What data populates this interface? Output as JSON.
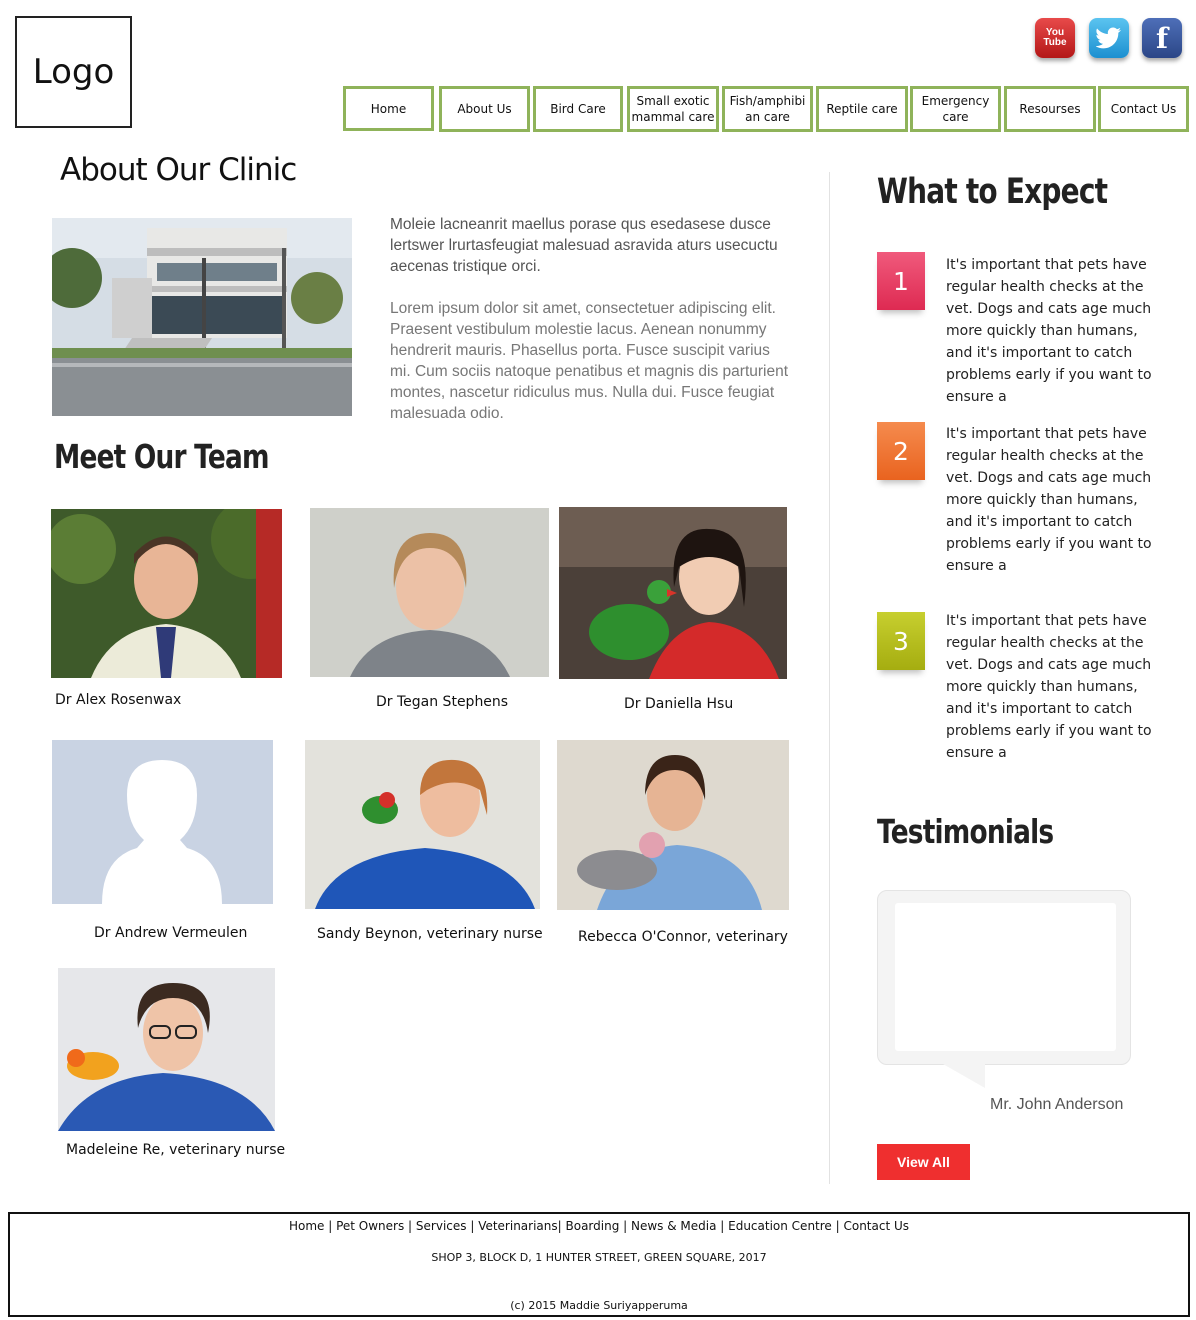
{
  "header": {
    "logo_text": "Logo",
    "social": [
      {
        "name": "youtube",
        "label": "You\nTube",
        "color": "#d32323"
      },
      {
        "name": "twitter",
        "label": "t",
        "color": "#2aa9e0"
      },
      {
        "name": "facebook",
        "label": "f",
        "color": "#3b5998"
      }
    ]
  },
  "nav": {
    "items": [
      "Home",
      "About Us",
      "Bird Care",
      "Small exotic mammal care",
      "Fish/amphibian care",
      "Reptile care",
      "Emergency care",
      "Resourses",
      "Contact Us"
    ],
    "border_color": "#8fb35a"
  },
  "about": {
    "title": "About Our Clinic",
    "para1": "Moleie lacneanrit maellus porase qus esedasese dusce lertswer lrurtasfeugiat malesuad asravida aturs usecuctu aecenas tristique orci.",
    "para2": "Lorem ipsum dolor sit amet, consectetuer adipiscing elit. Praesent vestibulum molestie lacus. Aenean nonummy hendrerit mauris. Phasellus porta. Fusce suscipit varius mi. Cum sociis natoque penatibus et magnis dis parturient montes, nascetur ridiculus mus. Nulla dui. Fusce feugiat malesuada odio."
  },
  "team": {
    "title": "Meet Our Team",
    "members": [
      "Dr Alex Rosenwax",
      "Dr Tegan Stephens",
      "Dr Daniella Hsu",
      "Dr Andrew Vermeulen",
      "Sandy Beynon, veterinary nurse",
      "Rebecca O'Connor, veterinary",
      "Madeleine Re, veterinary nurse"
    ]
  },
  "sidebar": {
    "expect_title": "What to Expect",
    "expect_items": [
      {
        "number": "1",
        "color": "#e8375f",
        "text": "It's important that pets have regular health checks at the vet. Dogs and cats age much more quickly than humans, and it's important to catch problems early if you want to ensure a"
      },
      {
        "number": "2",
        "color": "#f07532",
        "text": "It's important that pets have regular health checks at the vet. Dogs and cats age much more quickly than humans, and it's important to catch problems early if you want to ensure a"
      },
      {
        "number": "3",
        "color": "#b3bb1a",
        "text": "It's important that pets have regular health checks at the vet. Dogs and cats age much more quickly than humans, and it's important to catch problems early if you want to ensure a"
      }
    ],
    "testimonials_title": "Testimonials",
    "testimonial_name": "Mr. John Anderson",
    "view_all_label": "View All"
  },
  "footer": {
    "links": [
      "Home",
      "Pet Owners",
      "Services",
      "Veterinarians",
      "Boarding",
      "News & Media",
      "Education Centre",
      "Contact Us"
    ],
    "address": "SHOP 3, BLOCK D, 1 HUNTER STREET, GREEN SQUARE, 2017",
    "copyright": "(c) 2015 Maddie Suriyapperuma"
  }
}
